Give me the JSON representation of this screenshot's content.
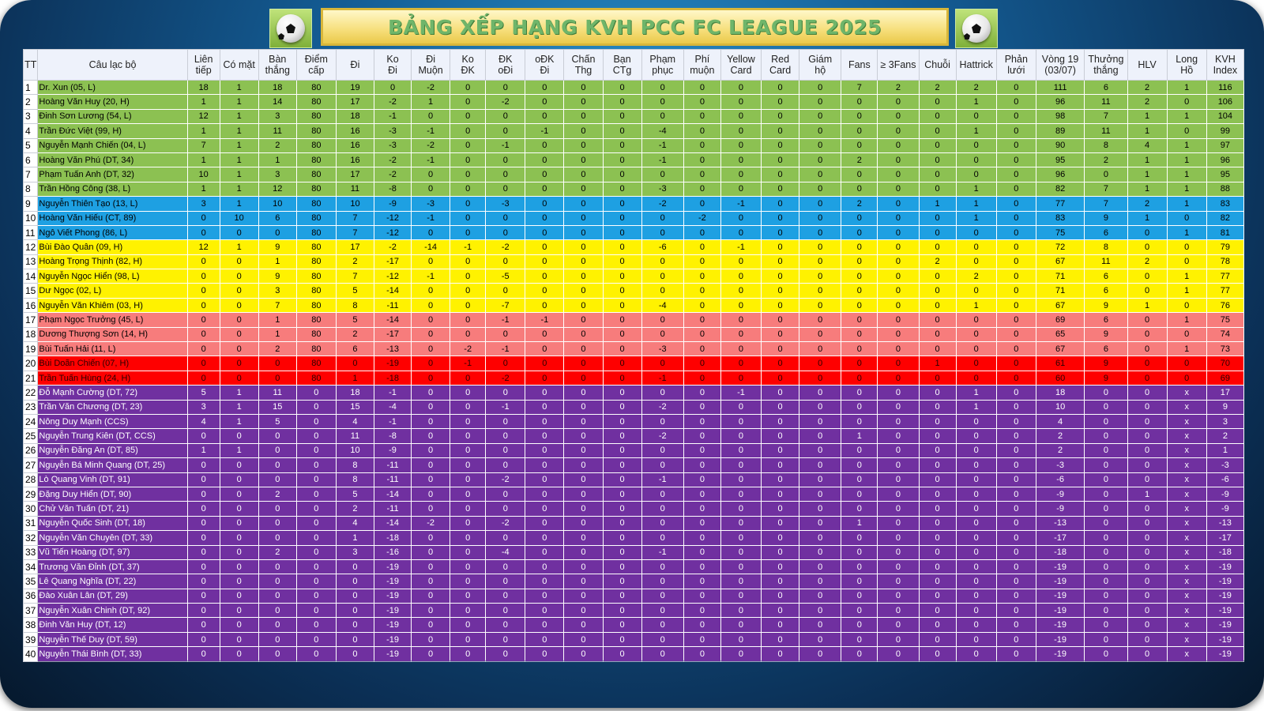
{
  "title": "BẢNG XẾP HẠNG KVH PCC FC LEAGUE 2025",
  "icons": {
    "left": "soccer-ball-icon",
    "right": "soccer-ball-icon"
  },
  "colors": {
    "green": "#8cc152",
    "blue": "#1ea0e2",
    "yellow": "#fff200",
    "pink": "#f77c7c",
    "red": "#fe0000",
    "purple": "#7030a0",
    "title_text": "#6fb56a",
    "title_bg": "#f6de7a"
  },
  "headers": [
    "TT",
    "Câu lạc bộ",
    "Liên\ntiếp",
    "Có mặt",
    "Bàn\nthắng",
    "Điểm\ncấp",
    "Đi",
    "Ko\nĐi",
    "Đi\nMuộn",
    "Ko\nĐK",
    "ĐK\noĐi",
    "oĐK\nĐi",
    "Chấn\nThg",
    "Bạn\nCTg",
    "Phạm\nphục",
    "Phí\nmuộn",
    "Yellow\nCard",
    "Red\nCard",
    "Giám\nhộ",
    "Fans",
    "≥ 3Fans",
    "Chuỗi",
    "Hattrick",
    "Phản\nlưới",
    "Vòng 19\n(03/07)",
    "Thưởng\nthắng",
    "HLV",
    "Long\nHồ",
    "KVH\nIndex"
  ],
  "rows": [
    {
      "band": "green",
      "cells": [
        "1",
        "Dr. Xun (05, L)",
        "18",
        "1",
        "18",
        "80",
        "19",
        "0",
        "-2",
        "0",
        "0",
        "0",
        "0",
        "0",
        "0",
        "0",
        "0",
        "0",
        "0",
        "7",
        "2",
        "2",
        "2",
        "0",
        "111",
        "6",
        "2",
        "1",
        "116"
      ]
    },
    {
      "band": "green",
      "cells": [
        "2",
        "Hoàng Văn Huy (20, H)",
        "1",
        "1",
        "14",
        "80",
        "17",
        "-2",
        "1",
        "0",
        "-2",
        "0",
        "0",
        "0",
        "0",
        "0",
        "0",
        "0",
        "0",
        "0",
        "0",
        "0",
        "1",
        "0",
        "96",
        "11",
        "2",
        "0",
        "106"
      ]
    },
    {
      "band": "green",
      "cells": [
        "3",
        "Đinh Sơn Lương (54, L)",
        "12",
        "1",
        "3",
        "80",
        "18",
        "-1",
        "0",
        "0",
        "0",
        "0",
        "0",
        "0",
        "0",
        "0",
        "0",
        "0",
        "0",
        "0",
        "0",
        "0",
        "0",
        "0",
        "98",
        "7",
        "1",
        "1",
        "104"
      ]
    },
    {
      "band": "green",
      "cells": [
        "4",
        "Trần Đức Việt (99, H)",
        "1",
        "1",
        "11",
        "80",
        "16",
        "-3",
        "-1",
        "0",
        "0",
        "-1",
        "0",
        "0",
        "-4",
        "0",
        "0",
        "0",
        "0",
        "0",
        "0",
        "0",
        "1",
        "0",
        "89",
        "11",
        "1",
        "0",
        "99"
      ]
    },
    {
      "band": "green",
      "cells": [
        "5",
        "Nguyễn Mạnh Chiến (04, L)",
        "7",
        "1",
        "2",
        "80",
        "16",
        "-3",
        "-2",
        "0",
        "-1",
        "0",
        "0",
        "0",
        "-1",
        "0",
        "0",
        "0",
        "0",
        "0",
        "0",
        "0",
        "0",
        "0",
        "90",
        "8",
        "4",
        "1",
        "97"
      ]
    },
    {
      "band": "green",
      "cells": [
        "6",
        "Hoàng Văn Phú (DT, 34)",
        "1",
        "1",
        "1",
        "80",
        "16",
        "-2",
        "-1",
        "0",
        "0",
        "0",
        "0",
        "0",
        "-1",
        "0",
        "0",
        "0",
        "0",
        "2",
        "0",
        "0",
        "0",
        "0",
        "95",
        "2",
        "1",
        "1",
        "96"
      ]
    },
    {
      "band": "green",
      "cells": [
        "7",
        "Phạm Tuấn Anh (DT, 32)",
        "10",
        "1",
        "3",
        "80",
        "17",
        "-2",
        "0",
        "0",
        "0",
        "0",
        "0",
        "0",
        "0",
        "0",
        "0",
        "0",
        "0",
        "0",
        "0",
        "0",
        "0",
        "0",
        "96",
        "0",
        "1",
        "1",
        "95"
      ]
    },
    {
      "band": "green",
      "cells": [
        "8",
        "Trần Hồng Công (38, L)",
        "1",
        "1",
        "12",
        "80",
        "11",
        "-8",
        "0",
        "0",
        "0",
        "0",
        "0",
        "0",
        "-3",
        "0",
        "0",
        "0",
        "0",
        "0",
        "0",
        "0",
        "1",
        "0",
        "82",
        "7",
        "1",
        "1",
        "88"
      ]
    },
    {
      "band": "blue",
      "cells": [
        "9",
        "Nguyễn Thiên Tạo (13, L)",
        "3",
        "1",
        "10",
        "80",
        "10",
        "-9",
        "-3",
        "0",
        "-3",
        "0",
        "0",
        "0",
        "-2",
        "0",
        "-1",
        "0",
        "0",
        "2",
        "0",
        "1",
        "1",
        "0",
        "77",
        "7",
        "2",
        "1",
        "83"
      ]
    },
    {
      "band": "blue",
      "cells": [
        "10",
        "Hoàng Văn Hiếu (CT, 89)",
        "0",
        "10",
        "6",
        "80",
        "7",
        "-12",
        "-1",
        "0",
        "0",
        "0",
        "0",
        "0",
        "0",
        "-2",
        "0",
        "0",
        "0",
        "0",
        "0",
        "0",
        "1",
        "0",
        "83",
        "9",
        "1",
        "0",
        "82"
      ]
    },
    {
      "band": "blue",
      "cells": [
        "11",
        "Ngô Viết Phong (86, L)",
        "0",
        "0",
        "0",
        "80",
        "7",
        "-12",
        "0",
        "0",
        "0",
        "0",
        "0",
        "0",
        "0",
        "0",
        "0",
        "0",
        "0",
        "0",
        "0",
        "0",
        "0",
        "0",
        "75",
        "6",
        "0",
        "1",
        "81"
      ]
    },
    {
      "band": "yellow",
      "cells": [
        "12",
        "Bùi Đào Quân (09, H)",
        "12",
        "1",
        "9",
        "80",
        "17",
        "-2",
        "-14",
        "-1",
        "-2",
        "0",
        "0",
        "0",
        "-6",
        "0",
        "-1",
        "0",
        "0",
        "0",
        "0",
        "0",
        "0",
        "0",
        "72",
        "8",
        "0",
        "0",
        "79"
      ]
    },
    {
      "band": "yellow",
      "cells": [
        "13",
        "Hoàng Trọng Thịnh (82, H)",
        "0",
        "0",
        "1",
        "80",
        "2",
        "-17",
        "0",
        "0",
        "0",
        "0",
        "0",
        "0",
        "0",
        "0",
        "0",
        "0",
        "0",
        "0",
        "0",
        "2",
        "0",
        "0",
        "67",
        "11",
        "2",
        "0",
        "78"
      ]
    },
    {
      "band": "yellow",
      "cells": [
        "14",
        "Nguyễn Ngọc Hiển (98, L)",
        "0",
        "0",
        "9",
        "80",
        "7",
        "-12",
        "-1",
        "0",
        "-5",
        "0",
        "0",
        "0",
        "0",
        "0",
        "0",
        "0",
        "0",
        "0",
        "0",
        "0",
        "2",
        "0",
        "71",
        "6",
        "0",
        "1",
        "77"
      ]
    },
    {
      "band": "yellow",
      "cells": [
        "15",
        "Dư Ngọc (02, L)",
        "0",
        "0",
        "3",
        "80",
        "5",
        "-14",
        "0",
        "0",
        "0",
        "0",
        "0",
        "0",
        "0",
        "0",
        "0",
        "0",
        "0",
        "0",
        "0",
        "0",
        "0",
        "0",
        "71",
        "6",
        "0",
        "1",
        "77"
      ]
    },
    {
      "band": "yellow",
      "cells": [
        "16",
        "Nguyễn Văn Khiêm (03, H)",
        "0",
        "0",
        "7",
        "80",
        "8",
        "-11",
        "0",
        "0",
        "-7",
        "0",
        "0",
        "0",
        "-4",
        "0",
        "0",
        "0",
        "0",
        "0",
        "0",
        "0",
        "1",
        "0",
        "67",
        "9",
        "1",
        "0",
        "76"
      ]
    },
    {
      "band": "pink",
      "cells": [
        "17",
        "Phạm Ngọc Trưởng (45, L)",
        "0",
        "0",
        "1",
        "80",
        "5",
        "-14",
        "0",
        "0",
        "-1",
        "-1",
        "0",
        "0",
        "0",
        "0",
        "0",
        "0",
        "0",
        "0",
        "0",
        "0",
        "0",
        "0",
        "69",
        "6",
        "0",
        "1",
        "75"
      ]
    },
    {
      "band": "pink",
      "cells": [
        "18",
        "Dương Thượng Sơn (14, H)",
        "0",
        "0",
        "1",
        "80",
        "2",
        "-17",
        "0",
        "0",
        "0",
        "0",
        "0",
        "0",
        "0",
        "0",
        "0",
        "0",
        "0",
        "0",
        "0",
        "0",
        "0",
        "0",
        "65",
        "9",
        "0",
        "0",
        "74"
      ]
    },
    {
      "band": "pink",
      "cells": [
        "19",
        "Bùi Tuấn Hải (11, L)",
        "0",
        "0",
        "2",
        "80",
        "6",
        "-13",
        "0",
        "-2",
        "-1",
        "0",
        "0",
        "0",
        "-3",
        "0",
        "0",
        "0",
        "0",
        "0",
        "0",
        "0",
        "0",
        "0",
        "67",
        "6",
        "0",
        "1",
        "73"
      ]
    },
    {
      "band": "red",
      "cells": [
        "20",
        "Bùi Doãn Chiến (07, H)",
        "0",
        "0",
        "0",
        "80",
        "0",
        "-19",
        "0",
        "-1",
        "0",
        "0",
        "0",
        "0",
        "0",
        "0",
        "0",
        "0",
        "0",
        "0",
        "0",
        "1",
        "0",
        "0",
        "61",
        "9",
        "0",
        "0",
        "70"
      ]
    },
    {
      "band": "red",
      "cells": [
        "21",
        "Trần Tuấn Hùng (24, H)",
        "0",
        "0",
        "0",
        "80",
        "1",
        "-18",
        "0",
        "0",
        "-2",
        "0",
        "0",
        "0",
        "-1",
        "0",
        "0",
        "0",
        "0",
        "0",
        "0",
        "0",
        "0",
        "0",
        "60",
        "9",
        "0",
        "0",
        "69"
      ]
    },
    {
      "band": "purple",
      "cells": [
        "22",
        "Đỗ Mạnh Cường (DT, 72)",
        "5",
        "1",
        "11",
        "0",
        "18",
        "-1",
        "0",
        "0",
        "0",
        "0",
        "0",
        "0",
        "0",
        "0",
        "-1",
        "0",
        "0",
        "0",
        "0",
        "0",
        "1",
        "0",
        "18",
        "0",
        "0",
        "x",
        "17"
      ]
    },
    {
      "band": "purple",
      "cells": [
        "23",
        "Trần Văn Chương (DT, 23)",
        "3",
        "1",
        "15",
        "0",
        "15",
        "-4",
        "0",
        "0",
        "-1",
        "0",
        "0",
        "0",
        "-2",
        "0",
        "0",
        "0",
        "0",
        "0",
        "0",
        "0",
        "1",
        "0",
        "10",
        "0",
        "0",
        "x",
        "9"
      ]
    },
    {
      "band": "purple",
      "cells": [
        "24",
        "Nông Duy Mạnh (CCS)",
        "4",
        "1",
        "5",
        "0",
        "4",
        "-1",
        "0",
        "0",
        "0",
        "0",
        "0",
        "0",
        "0",
        "0",
        "0",
        "0",
        "0",
        "0",
        "0",
        "0",
        "0",
        "0",
        "4",
        "0",
        "0",
        "x",
        "3"
      ]
    },
    {
      "band": "purple",
      "cells": [
        "25",
        "Nguyễn Trung Kiên (DT, CCS)",
        "0",
        "0",
        "0",
        "0",
        "11",
        "-8",
        "0",
        "0",
        "0",
        "0",
        "0",
        "0",
        "-2",
        "0",
        "0",
        "0",
        "0",
        "1",
        "0",
        "0",
        "0",
        "0",
        "2",
        "0",
        "0",
        "x",
        "2"
      ]
    },
    {
      "band": "purple",
      "cells": [
        "26",
        "Nguyễn Đăng An (DT, 85)",
        "1",
        "1",
        "0",
        "0",
        "10",
        "-9",
        "0",
        "0",
        "0",
        "0",
        "0",
        "0",
        "0",
        "0",
        "0",
        "0",
        "0",
        "0",
        "0",
        "0",
        "0",
        "0",
        "2",
        "0",
        "0",
        "x",
        "1"
      ]
    },
    {
      "band": "purple",
      "cells": [
        "27",
        "Nguyễn Bá Minh Quang (DT, 25)",
        "0",
        "0",
        "0",
        "0",
        "8",
        "-11",
        "0",
        "0",
        "0",
        "0",
        "0",
        "0",
        "0",
        "0",
        "0",
        "0",
        "0",
        "0",
        "0",
        "0",
        "0",
        "0",
        "-3",
        "0",
        "0",
        "x",
        "-3"
      ]
    },
    {
      "band": "purple",
      "cells": [
        "28",
        "Lò Quang Vinh (DT, 91)",
        "0",
        "0",
        "0",
        "0",
        "8",
        "-11",
        "0",
        "0",
        "-2",
        "0",
        "0",
        "0",
        "-1",
        "0",
        "0",
        "0",
        "0",
        "0",
        "0",
        "0",
        "0",
        "0",
        "-6",
        "0",
        "0",
        "x",
        "-6"
      ]
    },
    {
      "band": "purple",
      "cells": [
        "29",
        "Đặng Duy Hiển (DT, 90)",
        "0",
        "0",
        "2",
        "0",
        "5",
        "-14",
        "0",
        "0",
        "0",
        "0",
        "0",
        "0",
        "0",
        "0",
        "0",
        "0",
        "0",
        "0",
        "0",
        "0",
        "0",
        "0",
        "-9",
        "0",
        "1",
        "x",
        "-9"
      ]
    },
    {
      "band": "purple",
      "cells": [
        "30",
        "Chử Văn Tuấn (DT, 21)",
        "0",
        "0",
        "0",
        "0",
        "2",
        "-11",
        "0",
        "0",
        "0",
        "0",
        "0",
        "0",
        "0",
        "0",
        "0",
        "0",
        "0",
        "0",
        "0",
        "0",
        "0",
        "0",
        "-9",
        "0",
        "0",
        "x",
        "-9"
      ]
    },
    {
      "band": "purple",
      "cells": [
        "31",
        "Nguyễn Quốc Sinh (DT, 18)",
        "0",
        "0",
        "0",
        "0",
        "4",
        "-14",
        "-2",
        "0",
        "-2",
        "0",
        "0",
        "0",
        "0",
        "0",
        "0",
        "0",
        "0",
        "1",
        "0",
        "0",
        "0",
        "0",
        "-13",
        "0",
        "0",
        "x",
        "-13"
      ]
    },
    {
      "band": "purple",
      "cells": [
        "32",
        "Nguyễn Văn Chuyên (DT, 33)",
        "0",
        "0",
        "0",
        "0",
        "1",
        "-18",
        "0",
        "0",
        "0",
        "0",
        "0",
        "0",
        "0",
        "0",
        "0",
        "0",
        "0",
        "0",
        "0",
        "0",
        "0",
        "0",
        "-17",
        "0",
        "0",
        "x",
        "-17"
      ]
    },
    {
      "band": "purple",
      "cells": [
        "33",
        "Vũ Tiến Hoàng (DT, 97)",
        "0",
        "0",
        "2",
        "0",
        "3",
        "-16",
        "0",
        "0",
        "-4",
        "0",
        "0",
        "0",
        "-1",
        "0",
        "0",
        "0",
        "0",
        "0",
        "0",
        "0",
        "0",
        "0",
        "-18",
        "0",
        "0",
        "x",
        "-18"
      ]
    },
    {
      "band": "purple",
      "cells": [
        "34",
        "Trương Văn Đỉnh (DT, 37)",
        "0",
        "0",
        "0",
        "0",
        "0",
        "-19",
        "0",
        "0",
        "0",
        "0",
        "0",
        "0",
        "0",
        "0",
        "0",
        "0",
        "0",
        "0",
        "0",
        "0",
        "0",
        "0",
        "-19",
        "0",
        "0",
        "x",
        "-19"
      ]
    },
    {
      "band": "purple",
      "cells": [
        "35",
        "Lê Quang Nghĩa (DT, 22)",
        "0",
        "0",
        "0",
        "0",
        "0",
        "-19",
        "0",
        "0",
        "0",
        "0",
        "0",
        "0",
        "0",
        "0",
        "0",
        "0",
        "0",
        "0",
        "0",
        "0",
        "0",
        "0",
        "-19",
        "0",
        "0",
        "x",
        "-19"
      ]
    },
    {
      "band": "purple",
      "cells": [
        "36",
        "Đào Xuân Lân (DT, 29)",
        "0",
        "0",
        "0",
        "0",
        "0",
        "-19",
        "0",
        "0",
        "0",
        "0",
        "0",
        "0",
        "0",
        "0",
        "0",
        "0",
        "0",
        "0",
        "0",
        "0",
        "0",
        "0",
        "-19",
        "0",
        "0",
        "x",
        "-19"
      ]
    },
    {
      "band": "purple",
      "cells": [
        "37",
        "Nguyễn Xuân Chinh (DT, 92)",
        "0",
        "0",
        "0",
        "0",
        "0",
        "-19",
        "0",
        "0",
        "0",
        "0",
        "0",
        "0",
        "0",
        "0",
        "0",
        "0",
        "0",
        "0",
        "0",
        "0",
        "0",
        "0",
        "-19",
        "0",
        "0",
        "x",
        "-19"
      ]
    },
    {
      "band": "purple",
      "cells": [
        "38",
        "Đinh Văn Huy (DT, 12)",
        "0",
        "0",
        "0",
        "0",
        "0",
        "-19",
        "0",
        "0",
        "0",
        "0",
        "0",
        "0",
        "0",
        "0",
        "0",
        "0",
        "0",
        "0",
        "0",
        "0",
        "0",
        "0",
        "-19",
        "0",
        "0",
        "x",
        "-19"
      ]
    },
    {
      "band": "purple",
      "cells": [
        "39",
        "Nguyễn Thế Duy (DT, 59)",
        "0",
        "0",
        "0",
        "0",
        "0",
        "-19",
        "0",
        "0",
        "0",
        "0",
        "0",
        "0",
        "0",
        "0",
        "0",
        "0",
        "0",
        "0",
        "0",
        "0",
        "0",
        "0",
        "-19",
        "0",
        "0",
        "x",
        "-19"
      ]
    },
    {
      "band": "purple",
      "cells": [
        "40",
        "Nguyễn Thái Bình (DT, 33)",
        "0",
        "0",
        "0",
        "0",
        "0",
        "-19",
        "0",
        "0",
        "0",
        "0",
        "0",
        "0",
        "0",
        "0",
        "0",
        "0",
        "0",
        "0",
        "0",
        "0",
        "0",
        "0",
        "-19",
        "0",
        "0",
        "x",
        "-19"
      ]
    }
  ]
}
